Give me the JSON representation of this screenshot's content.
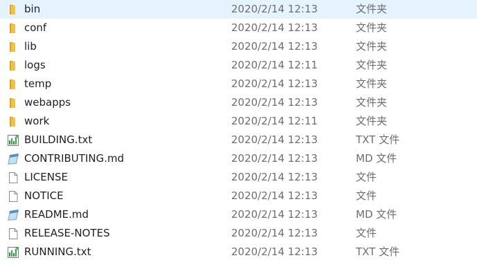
{
  "files": [
    {
      "name": "bin",
      "modified": "2020/2/14 12:13",
      "type": "文件夹",
      "icon": "folder-icon"
    },
    {
      "name": "conf",
      "modified": "2020/2/14 12:13",
      "type": "文件夹",
      "icon": "folder-icon"
    },
    {
      "name": "lib",
      "modified": "2020/2/14 12:13",
      "type": "文件夹",
      "icon": "folder-icon"
    },
    {
      "name": "logs",
      "modified": "2020/2/14 12:11",
      "type": "文件夹",
      "icon": "folder-icon"
    },
    {
      "name": "temp",
      "modified": "2020/2/14 12:13",
      "type": "文件夹",
      "icon": "folder-icon"
    },
    {
      "name": "webapps",
      "modified": "2020/2/14 12:13",
      "type": "文件夹",
      "icon": "folder-icon"
    },
    {
      "name": "work",
      "modified": "2020/2/14 12:11",
      "type": "文件夹",
      "icon": "folder-icon"
    },
    {
      "name": "BUILDING.txt",
      "modified": "2020/2/14 12:13",
      "type": "TXT 文件",
      "icon": "text-file-icon"
    },
    {
      "name": "CONTRIBUTING.md",
      "modified": "2020/2/14 12:13",
      "type": "MD 文件",
      "icon": "markdown-file-icon"
    },
    {
      "name": "LICENSE",
      "modified": "2020/2/14 12:13",
      "type": "文件",
      "icon": "blank-file-icon"
    },
    {
      "name": "NOTICE",
      "modified": "2020/2/14 12:13",
      "type": "文件",
      "icon": "blank-file-icon"
    },
    {
      "name": "README.md",
      "modified": "2020/2/14 12:13",
      "type": "MD 文件",
      "icon": "markdown-file-icon"
    },
    {
      "name": "RELEASE-NOTES",
      "modified": "2020/2/14 12:13",
      "type": "文件",
      "icon": "blank-file-icon"
    },
    {
      "name": "RUNNING.txt",
      "modified": "2020/2/14 12:13",
      "type": "TXT 文件",
      "icon": "text-file-icon"
    }
  ],
  "colors": {
    "folder": "#f0c14b",
    "folder_dark": "#d9a520",
    "text_primary": "#1e1e1e",
    "text_secondary": "#6d6d6d",
    "hover": "#e5f3ff"
  }
}
